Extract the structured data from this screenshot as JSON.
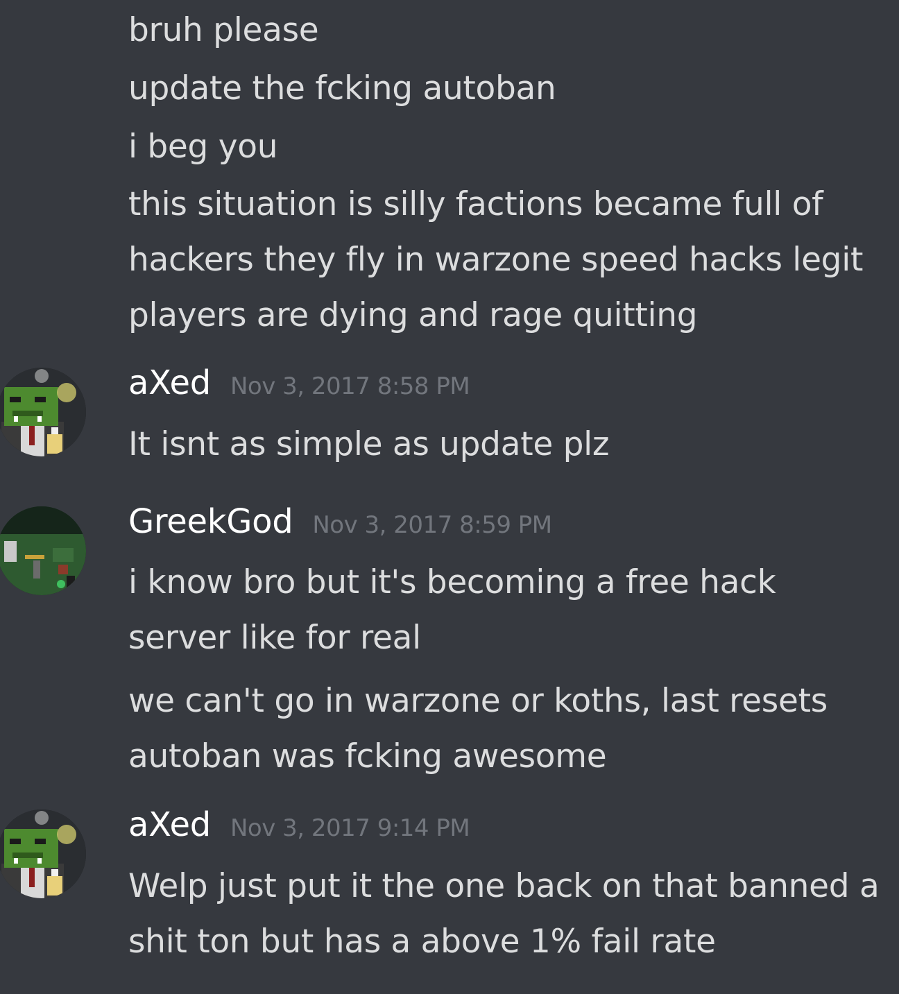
{
  "continued_messages": {
    "line1": "bruh please",
    "line2": "update the fcking autoban",
    "line3": "i beg you",
    "line4": "this situation is silly factions became full of hackers they fly in warzone speed hacks legit players are dying and rage quitting"
  },
  "groups": [
    {
      "author": "aXed",
      "timestamp": "Nov 3, 2017 8:58 PM",
      "avatar_icon": "orc-avatar-icon",
      "messages": [
        "It isnt as simple as update plz"
      ]
    },
    {
      "author": "GreekGod",
      "timestamp": "Nov 3, 2017 8:59 PM",
      "avatar_icon": "minecraft-scene-avatar-icon",
      "messages": [
        "i know bro but it's becoming a free hack server like for real",
        "we can't go in warzone or koths, last resets autoban was fcking awesome"
      ]
    },
    {
      "author": "aXed",
      "timestamp": "Nov 3, 2017 9:14 PM",
      "avatar_icon": "orc-avatar-icon",
      "messages": [
        "Welp just put it the one back on that banned a shit ton but has a above 1% fail rate"
      ]
    }
  ],
  "colors": {
    "background": "#36393f",
    "message_text": "#dcddde",
    "username": "#ffffff",
    "timestamp": "#72767d"
  }
}
